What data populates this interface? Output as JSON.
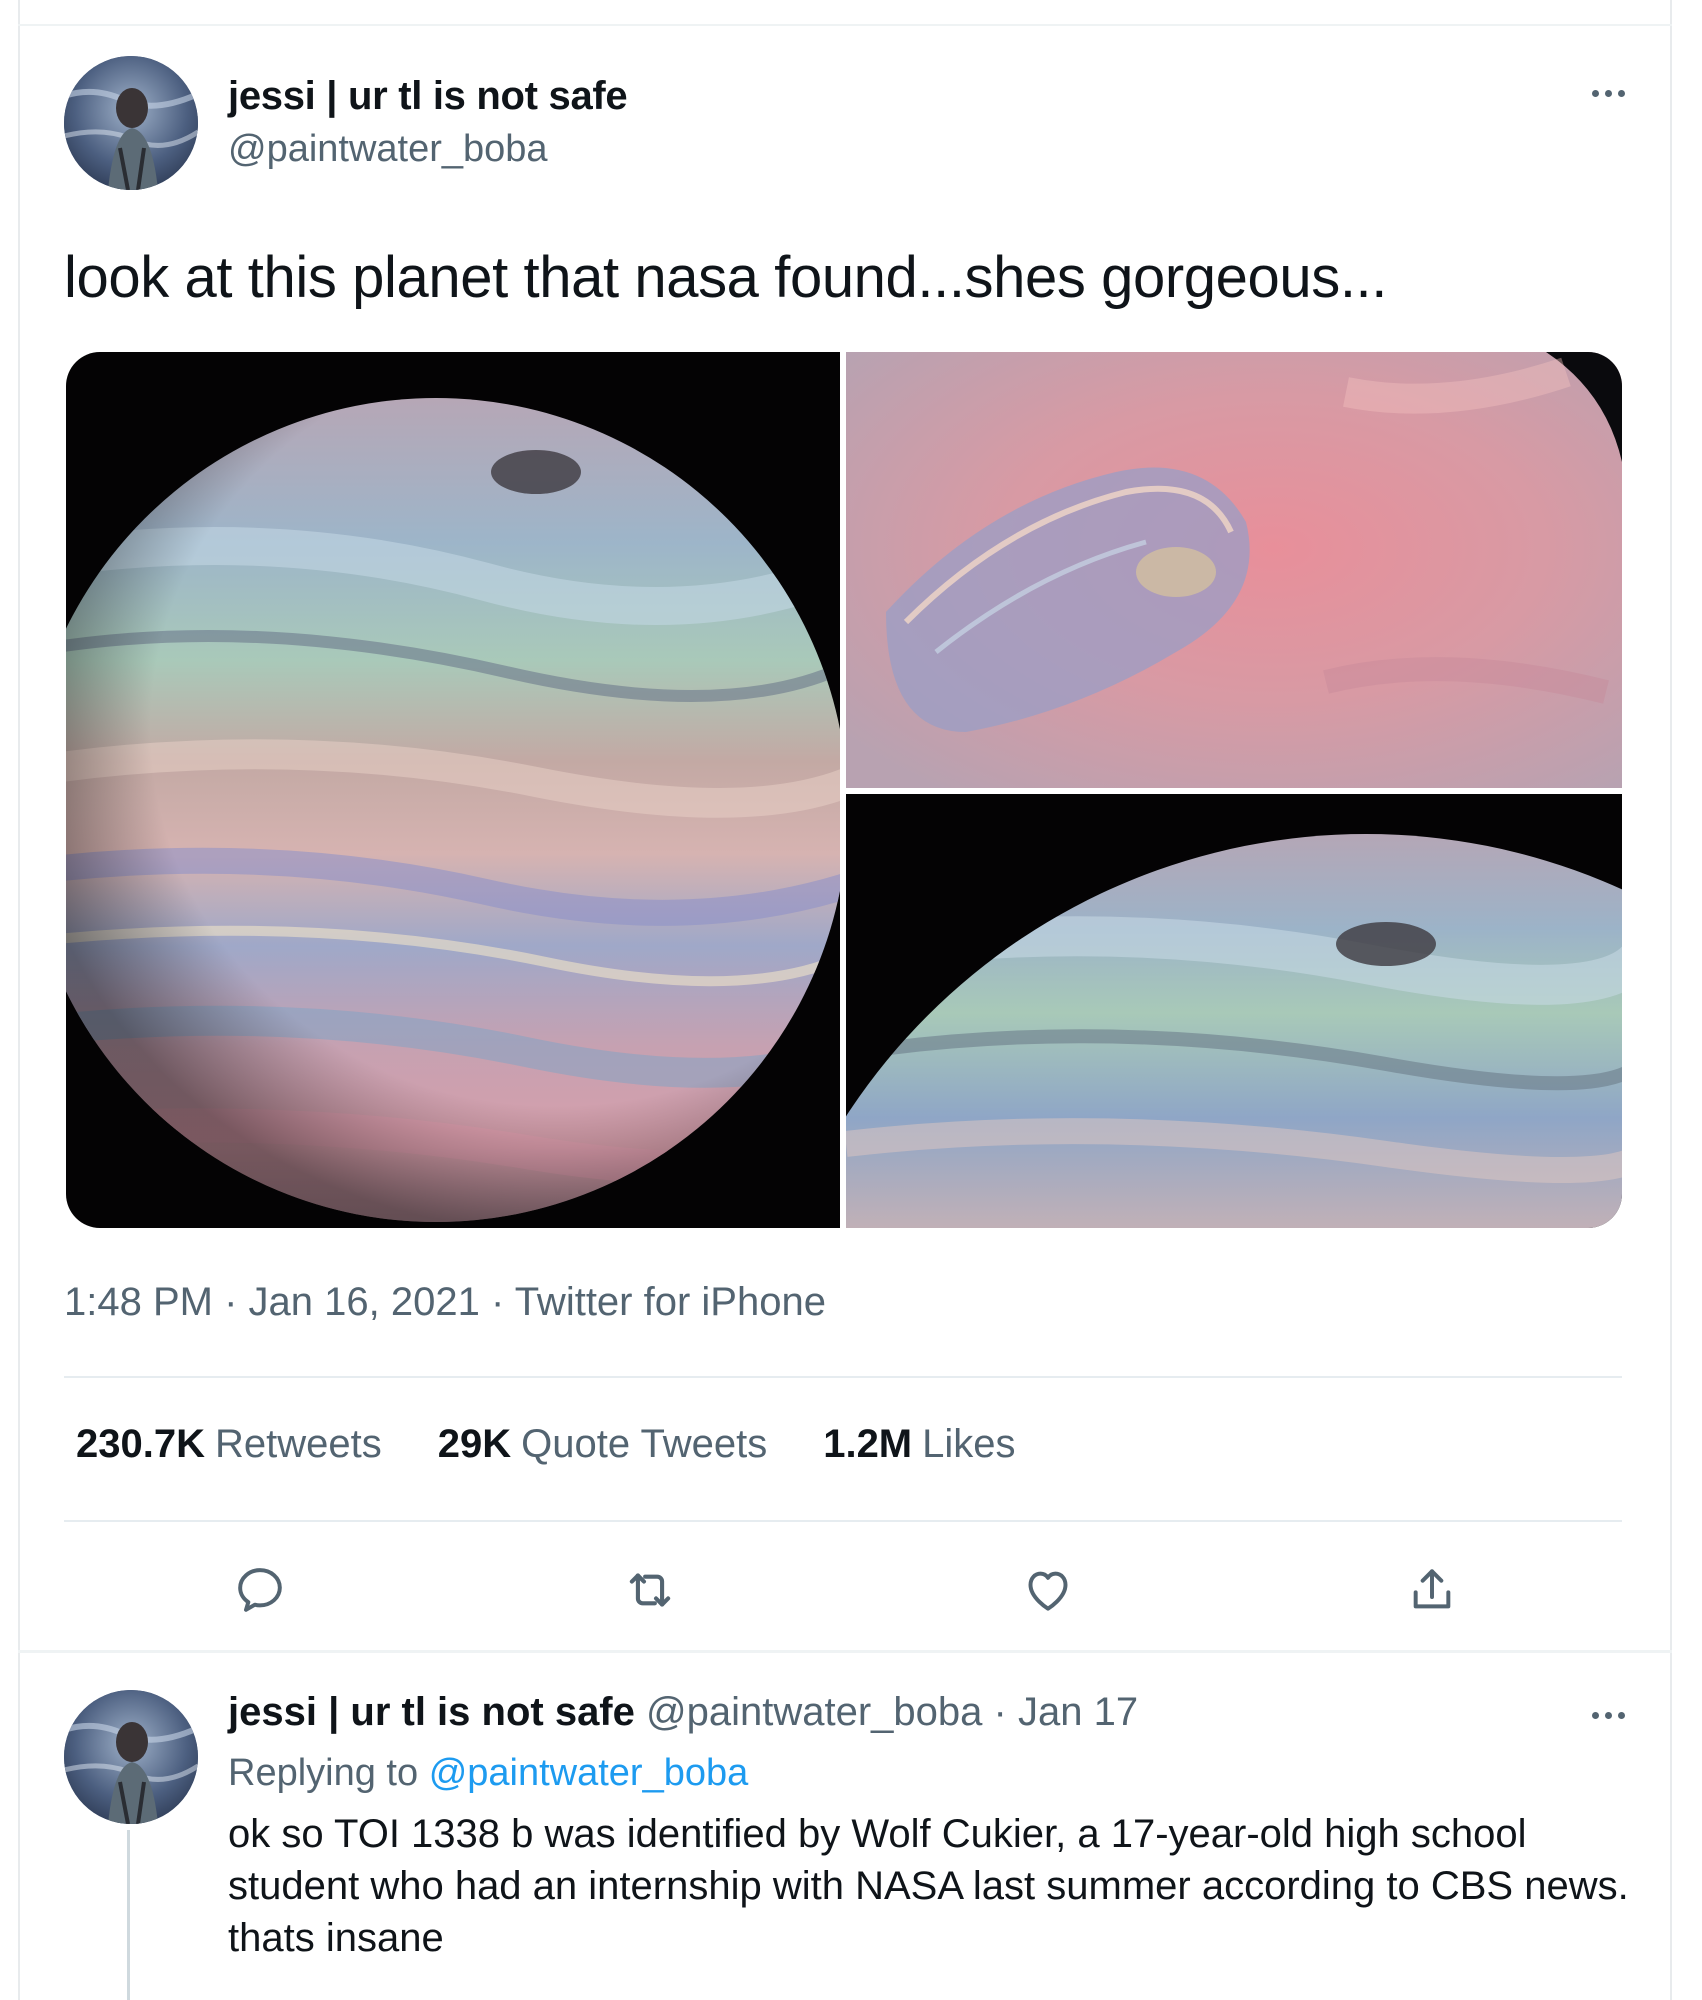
{
  "tweet": {
    "author_name": "jessi | ur tl is not safe",
    "author_handle": "@paintwater_boba",
    "text": "look at this planet that nasa found...shes gorgeous...",
    "time": "1:48 PM",
    "date": "Jan 16, 2021",
    "source": "Twitter for iPhone",
    "separator": "·",
    "stats": {
      "retweets_count": "230.7K",
      "retweets_label": "Retweets",
      "quotes_count": "29K",
      "quotes_label": "Quote Tweets",
      "likes_count": "1.2M",
      "likes_label": "Likes"
    },
    "media": [
      "planet-image-1",
      "planet-image-2",
      "planet-image-3"
    ]
  },
  "reply": {
    "author_name": "jessi | ur tl is not safe",
    "author_handle": "@paintwater_boba",
    "date": "Jan 17",
    "separator": "·",
    "replying_prefix": "Replying to",
    "replying_handle": "@paintwater_boba",
    "text": "ok so TOI 1338 b was identified by Wolf Cukier, a 17-year-old high school student who had an internship with NASA last summer according to CBS news. thats insane"
  },
  "icons": {
    "more": "more-horizontal-icon",
    "reply": "reply-icon",
    "retweet": "retweet-icon",
    "like": "heart-icon",
    "share": "share-icon"
  },
  "colors": {
    "link_blue": "#1d9bf0",
    "secondary_text": "#536471",
    "primary_text": "#0f1419"
  }
}
